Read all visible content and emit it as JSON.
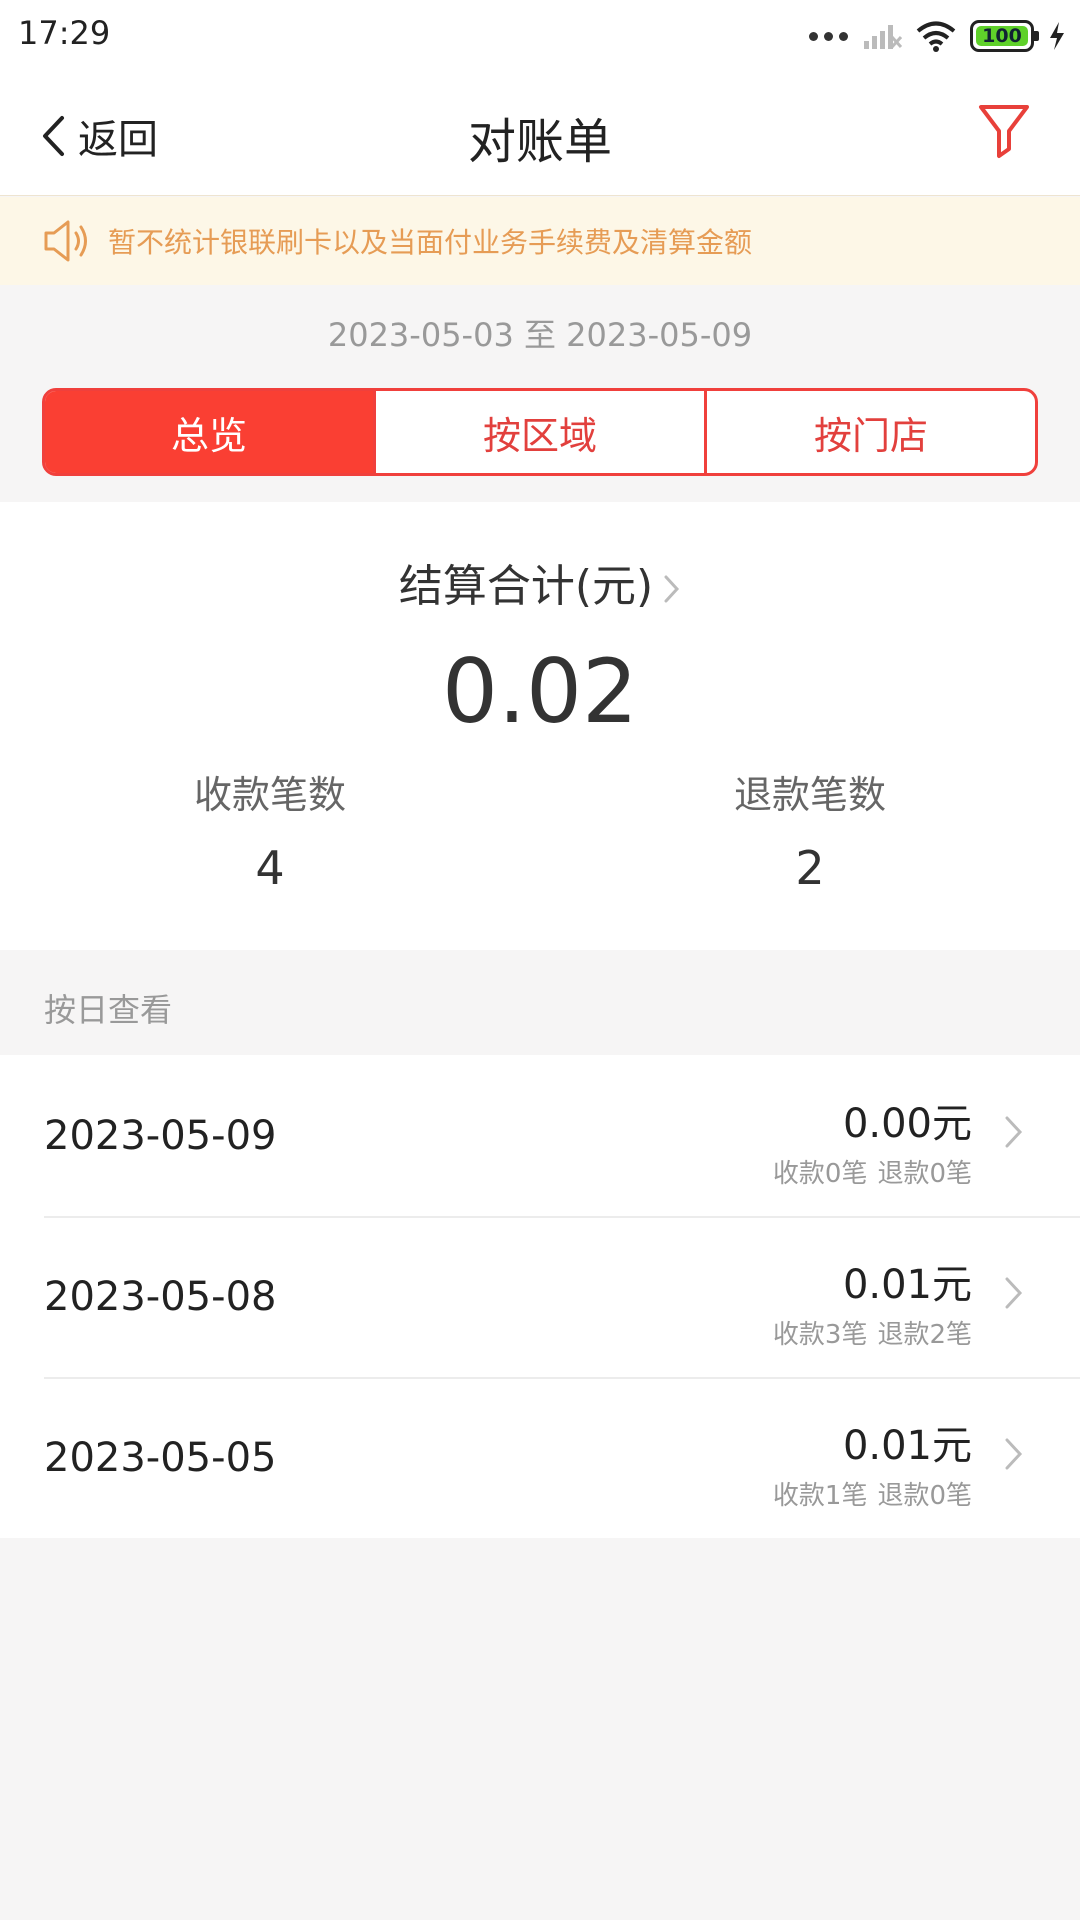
{
  "status": {
    "time": "17:29",
    "battery": "100"
  },
  "nav": {
    "back_label": "返回",
    "title": "对账单"
  },
  "notice": {
    "text": "暂不统计银联刷卡以及当面付业务手续费及清算金额"
  },
  "date_range": "2023-05-03 至 2023-05-09",
  "tabs": [
    {
      "label": "总览",
      "active": true
    },
    {
      "label": "按区域",
      "active": false
    },
    {
      "label": "按门店",
      "active": false
    }
  ],
  "summary": {
    "label": "结算合计(元)",
    "value": "0.02",
    "receipts_label": "收款笔数",
    "receipts_value": "4",
    "refunds_label": "退款笔数",
    "refunds_value": "2"
  },
  "section_header": "按日查看",
  "days": [
    {
      "date": "2023-05-09",
      "amount": "0.00元",
      "receipts": "收款0笔",
      "refunds": "退款0笔"
    },
    {
      "date": "2023-05-08",
      "amount": "0.01元",
      "receipts": "收款3笔",
      "refunds": "退款2笔"
    },
    {
      "date": "2023-05-05",
      "amount": "0.01元",
      "receipts": "收款1笔",
      "refunds": "退款0笔"
    }
  ],
  "colors": {
    "accent": "#fa3f33",
    "notice_bg": "#fdf7e7",
    "notice_text": "#e69c55"
  }
}
